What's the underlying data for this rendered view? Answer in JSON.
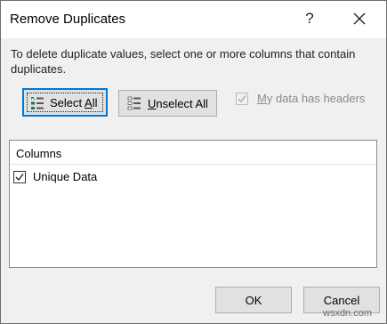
{
  "dialog": {
    "title": "Remove Duplicates",
    "help_glyph": "?",
    "instructions": "To delete duplicate values, select one or more columns that contain duplicates.",
    "select_all": {
      "pre": "Select ",
      "accel": "A",
      "post": "ll",
      "icon": "select-all-icon"
    },
    "unselect_all": {
      "pre": "",
      "accel": "U",
      "post": "nselect All",
      "icon": "unselect-all-icon"
    },
    "headers_checkbox": {
      "pre": "",
      "accel": "M",
      "post": "y data has headers",
      "checked": true,
      "disabled": true
    },
    "columns_header": "Columns",
    "columns": [
      {
        "label": "Unique Data",
        "checked": true
      }
    ],
    "ok_label": "OK",
    "cancel_label": "Cancel"
  },
  "watermark": "wsxdn.com",
  "colors": {
    "default_button_border": "#0078d7",
    "button_bg": "#e1e1e1",
    "dialog_bg": "#f0f0f0",
    "green_icon": "#217346"
  }
}
